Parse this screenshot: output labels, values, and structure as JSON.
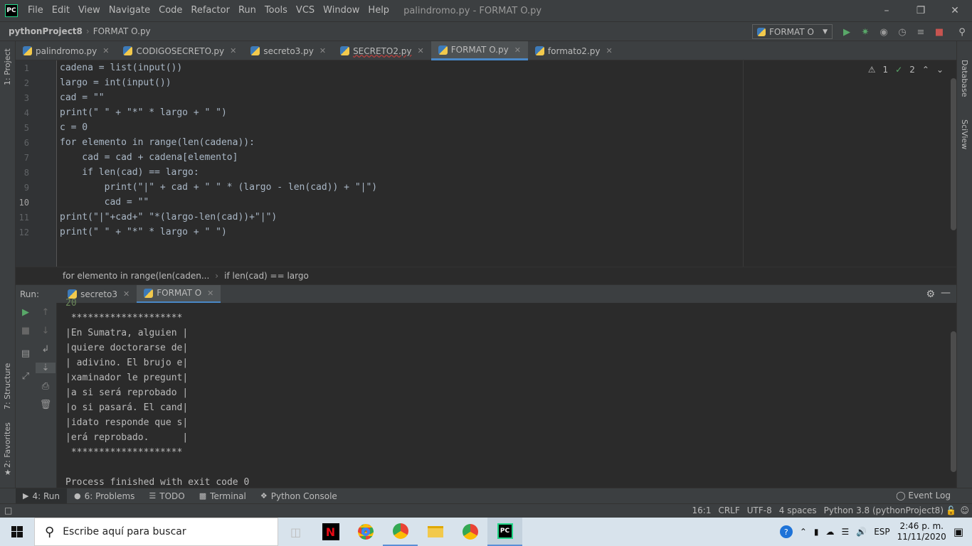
{
  "titlebar": {
    "menu": [
      "File",
      "Edit",
      "View",
      "Navigate",
      "Code",
      "Refactor",
      "Run",
      "Tools",
      "VCS",
      "Window",
      "Help"
    ],
    "window_title": "palindromo.py - FORMAT O.py",
    "logo": "PC"
  },
  "navbar": {
    "project": "pythonProject8",
    "file": "FORMAT O.py",
    "run_config": "FORMAT O"
  },
  "left_stripe": {
    "project": "1: Project",
    "structure": "7: Structure",
    "favorites": "2: Favorites"
  },
  "right_stripe": {
    "database": "Database",
    "sciview": "SciView"
  },
  "tabs": [
    {
      "label": "palindromo.py"
    },
    {
      "label": "CODIGOSECRETO.py"
    },
    {
      "label": "secreto3.py"
    },
    {
      "label": "SECRETO2.py"
    },
    {
      "label": "FORMAT O.py"
    },
    {
      "label": "formato2.py"
    }
  ],
  "inspections": {
    "warnings": "1",
    "weak": "2"
  },
  "line_numbers": [
    "1",
    "2",
    "3",
    "4",
    "5",
    "6",
    "7",
    "8",
    "9",
    "10",
    "11",
    "12"
  ],
  "code": [
    "cadena = list(input())",
    "largo = int(input())",
    "cad = \"\"",
    "print(\" \" + \"*\" * largo + \" \")",
    "c = 0",
    "for elemento in range(len(cadena)):",
    "    cad = cad + cadena[elemento]",
    "    if len(cad) == largo:",
    "        print(\"|\" + cad + \" \" * (largo - len(cad)) + \"|\")",
    "        cad = \"\"",
    "print(\"|\"+cad+\" \"*(largo-len(cad))+\"|\")",
    "print(\" \" + \"*\" * largo + \" \")"
  ],
  "breadcrumb": [
    "for elemento in range(len(caden...",
    "if len(cad) == largo"
  ],
  "run": {
    "label": "Run:",
    "tabs": [
      "secreto3",
      "FORMAT O"
    ],
    "output": [
      "20",
      " ********************",
      "|En Sumatra, alguien |",
      "|quiere doctorarse de|",
      "| adivino. El brujo e|",
      "|xaminador le pregunt|",
      "|a si será reprobado |",
      "|o si pasará. El cand|",
      "|idato responde que s|",
      "|erá reprobado.      |",
      " ********************",
      "",
      "Process finished with exit code 0"
    ]
  },
  "bottom_tools": [
    "4: Run",
    "6: Problems",
    "TODO",
    "Terminal",
    "Python Console"
  ],
  "event_log": "Event Log",
  "status": {
    "position": "16:1",
    "line_sep": "CRLF",
    "encoding": "UTF-8",
    "indent": "4 spaces",
    "interpreter": "Python 3.8 (pythonProject8)"
  },
  "taskbar": {
    "search_placeholder": "Escribe aquí para buscar",
    "lang": "ESP",
    "time": "2:46 p. m.",
    "date": "11/11/2020"
  }
}
